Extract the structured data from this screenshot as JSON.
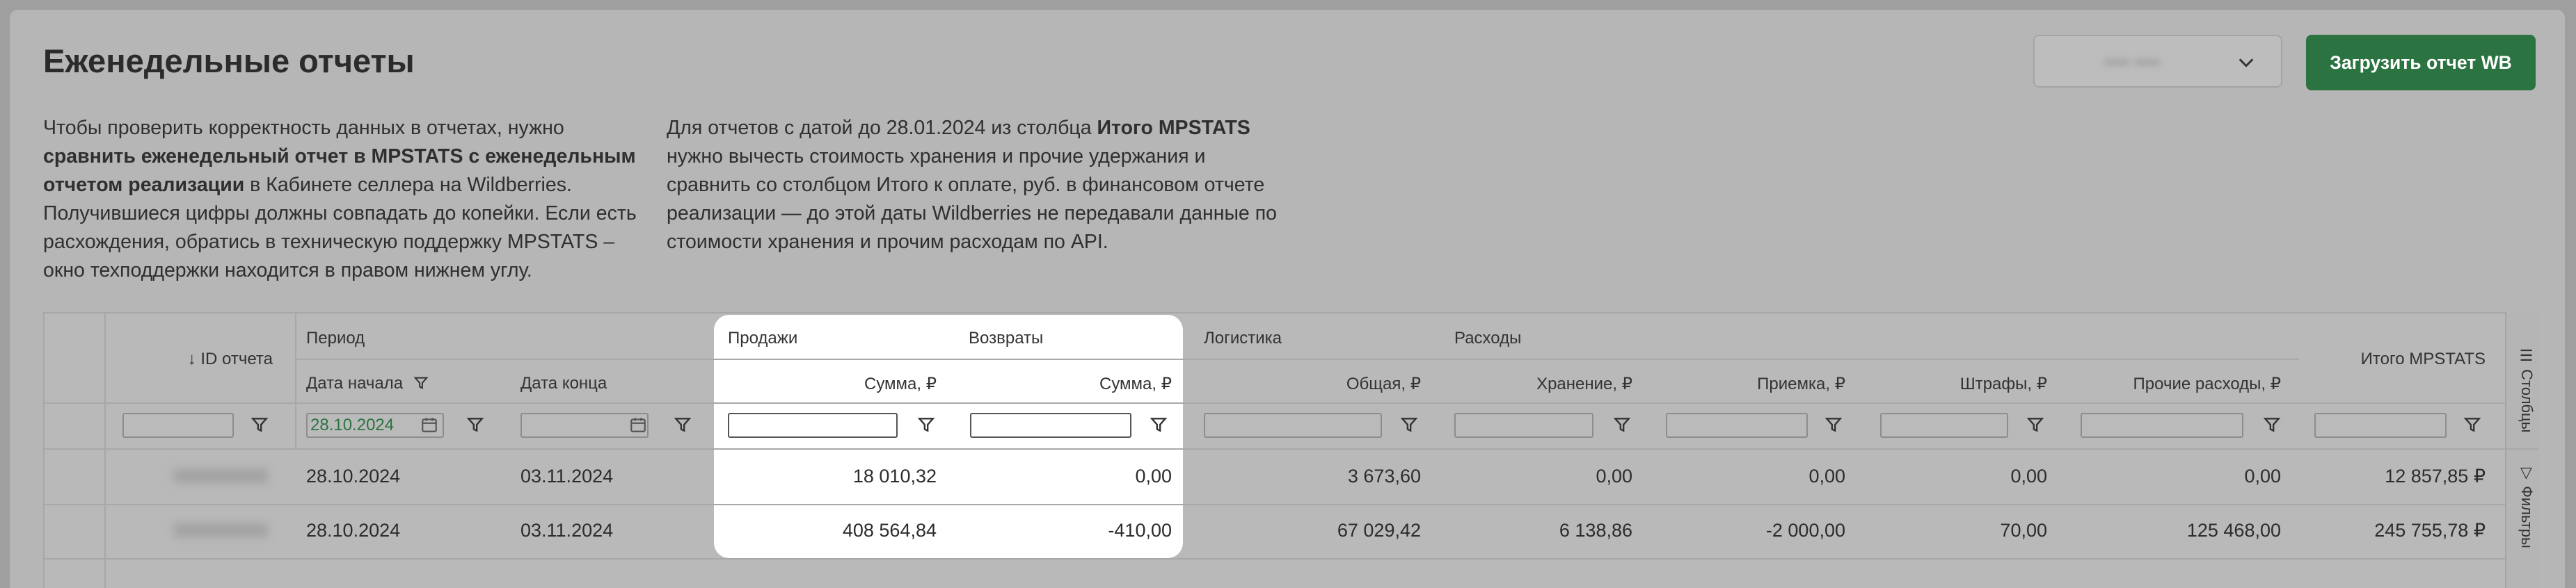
{
  "page": {
    "title": "Еженедельные отчеты",
    "desc_left": {
      "t1": "Чтобы проверить корректность данных в отчетах, нужно ",
      "b1": "сравнить еженедельный отчет в MPSTATS с еженедельным отчетом реализации",
      "t2": " в Кабинете селлера на Wildberries. Получившиеся цифры должны совпадать до копейки. Если есть расхождения, обратись в техническую поддержку MPSTATS – окно техподдержки находится в правом нижнем углу."
    },
    "desc_right": {
      "t1": "Для отчетов с датой до 28.01.2024 из столбца ",
      "b1": "Итого MPSTATS",
      "t2": " нужно вычесть стоимость хранения и прочие удержания и сравнить со столбцом Итого к оплате, руб. в финансовом отчете реализации — до этой даты Wildberries не передавали данные по стоимости хранения и прочим расходам по API."
    },
    "select_value": "•••• ••••",
    "upload_button": "Загрузить отчет WB"
  },
  "table": {
    "groups": {
      "period": "Период",
      "sales": "Продажи",
      "returns": "Возвраты",
      "logistics": "Логистика",
      "expenses": "Расходы"
    },
    "columns": {
      "id": "↓ ID отчета",
      "date_start": "Дата начала",
      "date_end": "Дата конца",
      "sales_sum": "Сумма, ₽",
      "returns_sum": "Сумма, ₽",
      "logistics_total": "Общая, ₽",
      "storage": "Хранение, ₽",
      "acceptance": "Приемка, ₽",
      "fines": "Штрафы, ₽",
      "other": "Прочие расходы, ₽",
      "total": "Итого MPSTATS"
    },
    "filter_date_value": "28.10.2024",
    "rows": [
      {
        "id": "000000000",
        "date_start": "28.10.2024",
        "date_end": "03.11.2024",
        "sales": "18 010,32",
        "returns": "0,00",
        "logistics": "3 673,60",
        "storage": "0,00",
        "acceptance": "0,00",
        "fines": "0,00",
        "other": "0,00",
        "total": "12 857,85 ₽"
      },
      {
        "id": "000000000",
        "date_start": "28.10.2024",
        "date_end": "03.11.2024",
        "sales": "408 564,84",
        "returns": "-410,00",
        "logistics": "67 029,42",
        "storage": "6 138,86",
        "acceptance": "-2 000,00",
        "fines": "70,00",
        "other": "125 468,00",
        "total": "245 755,78 ₽"
      }
    ],
    "side_tabs": {
      "columns": "Столбцы",
      "filters": "Фильтры"
    }
  },
  "colors": {
    "accent_green": "#2b7340",
    "overlay": "#9f9f9f",
    "highlight": "#ffffff"
  }
}
